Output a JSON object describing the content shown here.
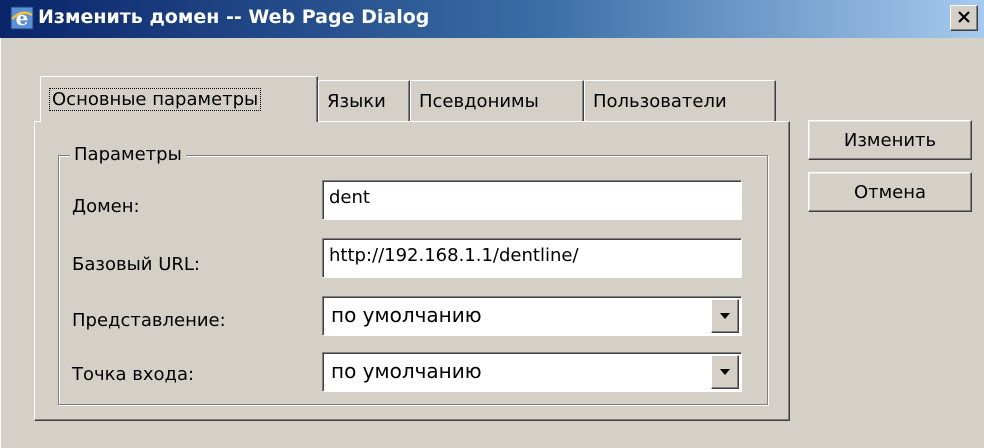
{
  "window": {
    "title": "Изменить домен -- Web Page Dialog",
    "icon": "ie-icon",
    "close_icon": "close-icon"
  },
  "tabs": [
    {
      "label": "Основные параметры",
      "active": true
    },
    {
      "label": "Языки",
      "active": false
    },
    {
      "label": "Псевдонимы",
      "active": false
    },
    {
      "label": "Пользователи",
      "active": false
    }
  ],
  "group": {
    "legend": "Параметры"
  },
  "fields": {
    "domain": {
      "label": "Домен:",
      "value": "dent"
    },
    "base_url": {
      "label": "Базовый URL:",
      "value": "http://192.168.1.1/dentline/"
    },
    "view": {
      "label": "Представление:",
      "value": "по умолчанию"
    },
    "entry_point": {
      "label": "Точка входа:",
      "value": "по умолчанию"
    }
  },
  "buttons": {
    "change": "Изменить",
    "cancel": "Отмена"
  },
  "colors": {
    "titlebar_start": "#0a246a",
    "titlebar_end": "#a6caf0",
    "face": "#d4d0c8"
  }
}
